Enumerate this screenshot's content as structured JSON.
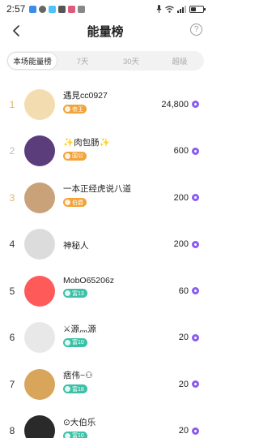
{
  "status_bar": {
    "time": "2:57"
  },
  "header": {
    "title": "能量榜",
    "help_glyph": "?"
  },
  "tabs": [
    {
      "label": "本场能量榜",
      "active": true
    },
    {
      "label": "7天",
      "active": false
    },
    {
      "label": "30天",
      "active": false
    },
    {
      "label": "超级",
      "active": false
    }
  ],
  "ranking": [
    {
      "rank": "1",
      "name": "遇見cc0927",
      "badge": "帝王",
      "badge_color": "#f2a33a",
      "score": "24,800",
      "avatar_color": "#f3ddb0"
    },
    {
      "rank": "2",
      "name": "✨肉包肠✨",
      "badge": "国公",
      "badge_color": "#f2a33a",
      "score": "600",
      "avatar_color": "#5a3d7a"
    },
    {
      "rank": "3",
      "name": "一本正经虎说八道",
      "badge": "伯爵",
      "badge_color": "#f2a33a",
      "score": "200",
      "avatar_color": "#c9a27a"
    },
    {
      "rank": "4",
      "name": "神秘人",
      "badge": "",
      "badge_color": "",
      "score": "200",
      "avatar_color": "#dcdcdc"
    },
    {
      "rank": "5",
      "name": "MobO65206z",
      "badge": "富13",
      "badge_color": "#3ec0a6",
      "score": "60",
      "avatar_color": "#ff5a5a"
    },
    {
      "rank": "6",
      "name": "⚔源灬源",
      "badge": "富10",
      "badge_color": "#3ec0a6",
      "score": "20",
      "avatar_color": "#e8e8e8"
    },
    {
      "rank": "7",
      "name": "痞伟~⚇",
      "badge": "富18",
      "badge_color": "#3ec0a6",
      "score": "20",
      "avatar_color": "#d9a55a"
    },
    {
      "rank": "8",
      "name": "⊙大伯乐",
      "badge": "富10",
      "badge_color": "#3ec0a6",
      "score": "20",
      "avatar_color": "#2a2a2a"
    }
  ]
}
